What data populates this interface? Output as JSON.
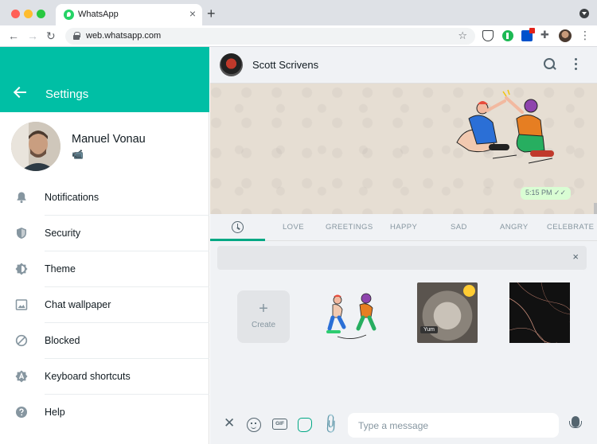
{
  "browser": {
    "tab_title": "WhatsApp",
    "tab_close": "×",
    "new_tab": "+",
    "url": "web.whatsapp.com",
    "nav": {
      "back": "←",
      "forward": "→",
      "reload": "↻"
    },
    "star": "☆",
    "puzzle": "✚",
    "more": "⋮"
  },
  "settings": {
    "title": "Settings",
    "profile": {
      "name": "Manuel Vonau",
      "status": "📹"
    },
    "items": [
      {
        "label": "Notifications",
        "icon": "bell-icon"
      },
      {
        "label": "Security",
        "icon": "shield-icon"
      },
      {
        "label": "Theme",
        "icon": "theme-icon"
      },
      {
        "label": "Chat wallpaper",
        "icon": "wallpaper-icon"
      },
      {
        "label": "Blocked",
        "icon": "blocked-icon"
      },
      {
        "label": "Keyboard shortcuts",
        "icon": "keyboard-shortcuts-icon"
      },
      {
        "label": "Help",
        "icon": "help-icon"
      }
    ]
  },
  "chat": {
    "contact_name": "Scott Scrivens",
    "message_time": "5:15 PM ✓✓",
    "sticker_tabs": [
      "LOVE",
      "GREETINGS",
      "HAPPY",
      "SAD",
      "ANGRY",
      "CELEBRATE"
    ],
    "search_clear": "×",
    "create": {
      "plus": "+",
      "label": "Create"
    },
    "hamster_tag": "Yum",
    "compose": {
      "close": "✕",
      "gif": "GIF",
      "attach": "📎",
      "placeholder": "Type a message"
    }
  },
  "colors": {
    "accent": "#00bfa5",
    "panel": "#f0f2f5",
    "wallpaper": "#e6ded3"
  }
}
